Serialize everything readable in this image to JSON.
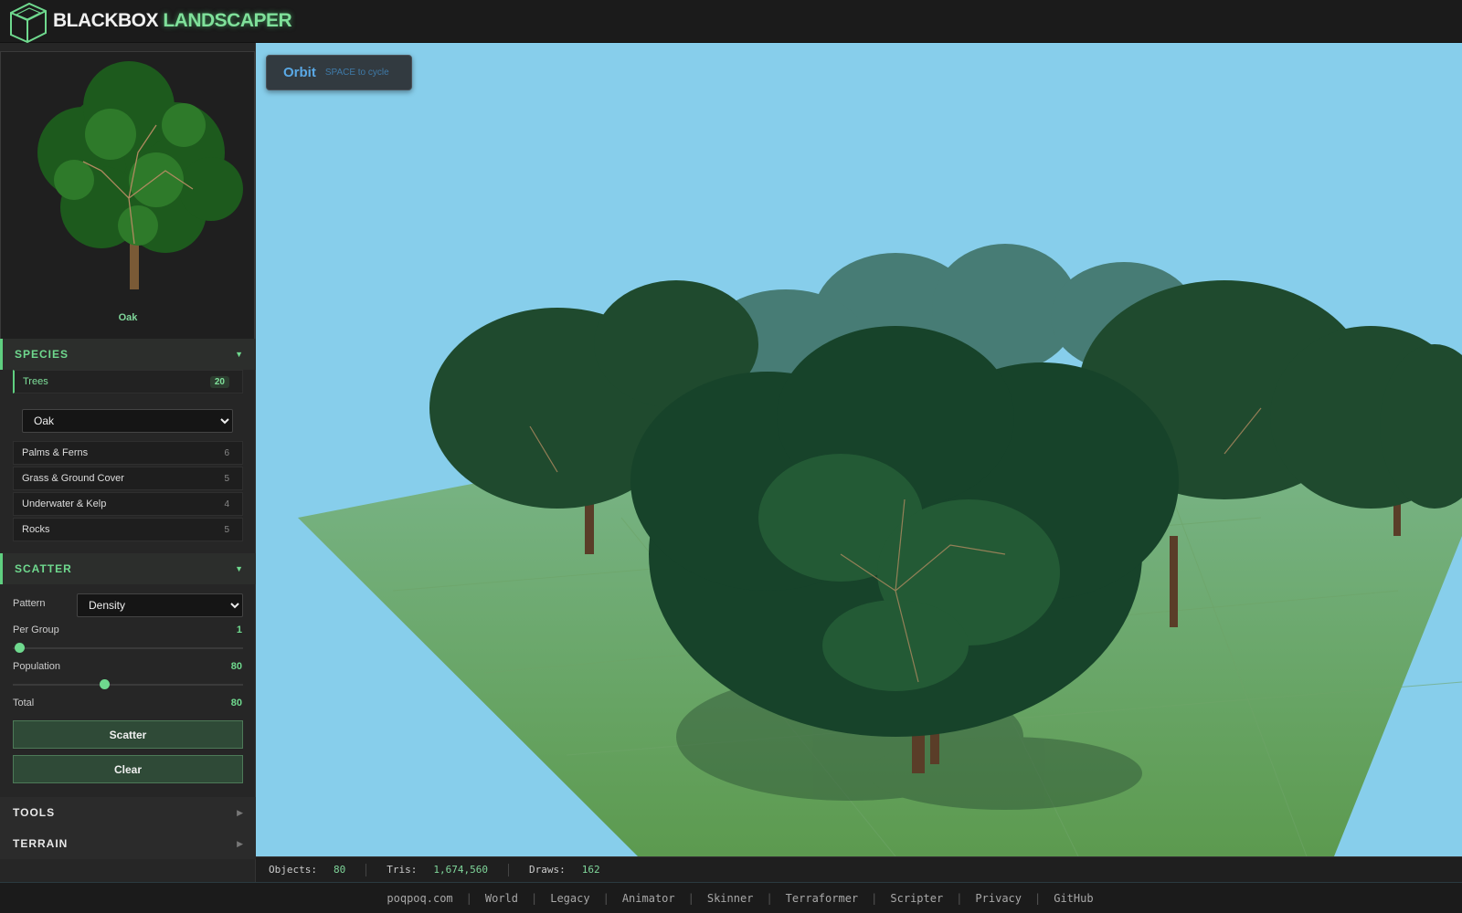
{
  "app": {
    "brand_white": "BLACKBOX",
    "brand_green": "LANDSCAPER"
  },
  "sidebar": {
    "preview_name": "Oak",
    "species": {
      "title": "SPECIES",
      "categories": [
        {
          "label": "Trees",
          "count": "20"
        },
        {
          "label": "Palms & Ferns",
          "count": "6"
        },
        {
          "label": "Grass & Ground Cover",
          "count": "5"
        },
        {
          "label": "Underwater & Kelp",
          "count": "4"
        },
        {
          "label": "Rocks",
          "count": "5"
        }
      ],
      "tree_select": "Oak"
    },
    "scatter": {
      "title": "SCATTER",
      "pattern_label": "Pattern",
      "pattern_value": "Density",
      "per_group_label": "Per Group",
      "per_group_value": "1",
      "population_label": "Population",
      "population_value": "80",
      "total_label": "Total",
      "total_value": "80",
      "scatter_button": "Scatter",
      "clear_button": "Clear"
    },
    "tools_title": "TOOLS",
    "terrain_title": "TERRAIN"
  },
  "viewport": {
    "mode": "Orbit",
    "mode_hint": "SPACE to cycle",
    "sky_color": "#87ceeb",
    "ground_color": "#5f9a55"
  },
  "stats": {
    "objects_label": "Objects:",
    "objects": "80",
    "tris_label": "Tris:",
    "tris": "1,674,560",
    "draws_label": "Draws:",
    "draws": "162"
  },
  "footer": {
    "links": [
      "poqpoq.com",
      "World",
      "Legacy",
      "Animator",
      "Skinner",
      "Terraformer",
      "Scripter",
      "Privacy",
      "GitHub"
    ]
  },
  "colors": {
    "accent": "#6fd98e"
  }
}
